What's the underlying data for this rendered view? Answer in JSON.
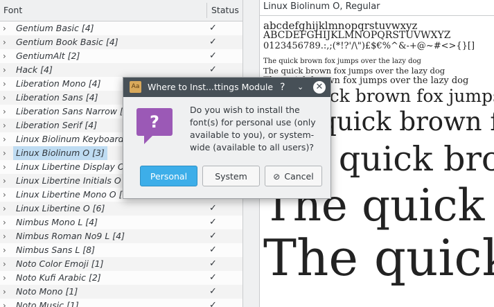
{
  "font_list": {
    "header": {
      "font": "Font",
      "status": "Status"
    },
    "rows": [
      {
        "name": "Gentium Basic [4]",
        "status": "✓"
      },
      {
        "name": "Gentium Book Basic [4]",
        "status": "✓"
      },
      {
        "name": "GentiumAlt [2]",
        "status": "✓"
      },
      {
        "name": "Hack [4]",
        "status": "✓"
      },
      {
        "name": "Liberation Mono [4]",
        "status": "✓"
      },
      {
        "name": "Liberation Sans [4]",
        "status": "✓"
      },
      {
        "name": "Liberation Sans Narrow [4]",
        "status": "✓"
      },
      {
        "name": "Liberation Serif [4]",
        "status": "✓"
      },
      {
        "name": "Linux Biolinum Keyboard O [1]",
        "status": ""
      },
      {
        "name": "Linux Biolinum O [3]",
        "status": ""
      },
      {
        "name": "Linux Libertine Display O [1]",
        "status": ""
      },
      {
        "name": "Linux Libertine Initials O [1]",
        "status": ""
      },
      {
        "name": "Linux Libertine Mono O [1]",
        "status": ""
      },
      {
        "name": "Linux Libertine O [6]",
        "status": "✓"
      },
      {
        "name": "Nimbus Mono L [4]",
        "status": "✓"
      },
      {
        "name": "Nimbus Roman No9 L [4]",
        "status": "✓"
      },
      {
        "name": "Nimbus Sans L [8]",
        "status": "✓"
      },
      {
        "name": "Noto Color Emoji [1]",
        "status": "✓"
      },
      {
        "name": "Noto Kufi Arabic [2]",
        "status": "✓"
      },
      {
        "name": "Noto Mono [1]",
        "status": "✓"
      },
      {
        "name": "Noto Music [1]",
        "status": "✓"
      }
    ],
    "selected_index": 9
  },
  "preview": {
    "title": "Linux Biolinum O, Regular",
    "lower": "abcdefghijklmnopqrstuvwxyz",
    "upper": "ABCDEFGHIJKLMNOPQRSTUVWXYZ",
    "symbols": "0123456789.:,;(*!?'/\\\")£$€%^&-+@~#<>{}[]",
    "sample_small_1": "The quick brown fox jumps over the lazy dog",
    "sample_small_2": "The quick brown fox jumps over the lazy dog",
    "sample_small_3": "The quick brown fox jumps over the lazy dog",
    "sample_medium": "The quick brown fox jumps over the lazy dog",
    "sample_large": "The quick brown fox jumps over the lazy dog",
    "sample_larger": "The quick brown fox jumps over the lazy dog",
    "sample_huge_1": "The quick brown fox jumps over the lazy dog",
    "sample_huge_2": "The quick brown fox jumps over the lazy dog"
  },
  "dialog": {
    "title": "Where to Inst...ttings Module",
    "help": "?",
    "minimize": "⌄",
    "close": "✕",
    "app_icon_text": "Aa",
    "question_icon_text": "?",
    "message": "Do you wish to install the font(s) for personal use (only available to you), or system-wide (available to all users)?",
    "buttons": {
      "personal": "Personal",
      "system": "System",
      "cancel": "Cancel",
      "cancel_icon": "⊘"
    }
  },
  "colors": {
    "accent": "#3daee9",
    "question_icon": "#9b59b6",
    "titlebar": "#475057",
    "selection": "#bfdcf2"
  }
}
